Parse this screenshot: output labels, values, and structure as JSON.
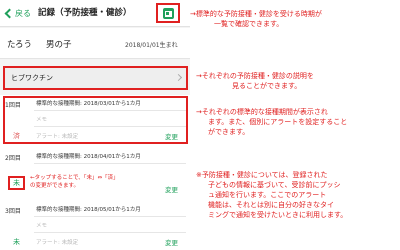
{
  "header": {
    "back_label": "戻る",
    "title": "記録（予防接種・健診）"
  },
  "child": {
    "name": "たろう",
    "gender": "男の子",
    "birthday": "2018/01/01生まれ"
  },
  "vaccine": {
    "name": "ヒブワクチン"
  },
  "doses": [
    {
      "label": "1回目",
      "period": "標準的な接種期間: 2018/03/01から1カ月",
      "memo": "メモ",
      "alert": "アラート: 未設定",
      "change": "変更",
      "status": "済"
    },
    {
      "label": "2回目",
      "period": "標準的な接種期間: 2018/04/01から1カ月",
      "memo": "メモ",
      "alert": "アラート: 未設定",
      "change": "変更",
      "status": "未"
    },
    {
      "label": "3回目",
      "period": "標準的な接種期間: 2018/05/01から1カ月",
      "memo": "メモ",
      "alert": "アラート: 未設定",
      "change": "変更",
      "status": "未"
    }
  ],
  "annotations": {
    "calendar": [
      "→標準的な予防接種・健診を受ける時期が",
      "一覧で確認できます。"
    ],
    "vaccine": [
      "→それぞれの予防接種・健診の説明を",
      "見ることができます。"
    ],
    "period": [
      "→それぞれの標準的な接種期間が表示され",
      "ます。また、個別にアラートを設定すること",
      "ができます。"
    ],
    "swipe": [
      "←タップすることで、「未」⇔「済」",
      "の変更ができます。"
    ],
    "note": [
      "※予防接種・健診については、登録された",
      "子どもの情報に基づいて、受診前にプッシ",
      "ュ通知を行います。ここでのアラート",
      "機能は、それとは別に自分の好きなタイ",
      "ミングで通知を受けたいときに利用します。"
    ]
  },
  "colors": {
    "accent_green": "#1fa05b",
    "annotation_red": "#e02020",
    "done_red": "#e06060"
  },
  "icons": {
    "back": "chevron-left-icon",
    "calendar": "calendar-icon",
    "vaccine_chevron": "chevron-right-icon"
  }
}
